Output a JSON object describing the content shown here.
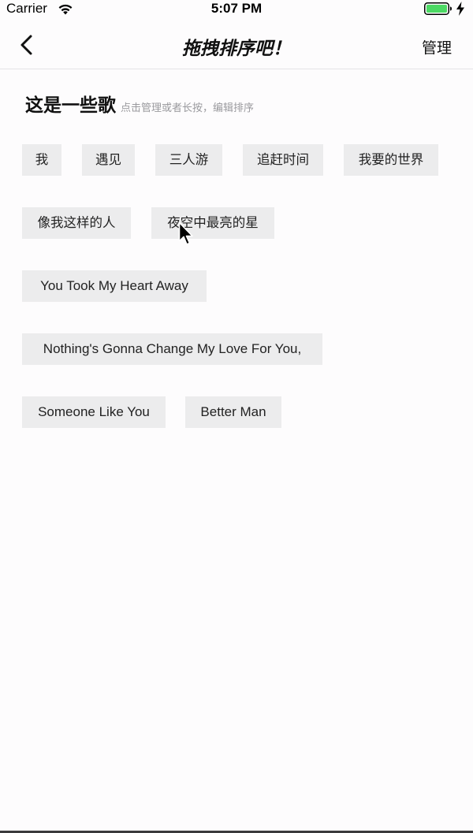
{
  "status_bar": {
    "carrier": "Carrier",
    "time": "5:07 PM",
    "icons": [
      "wifi-icon",
      "battery-icon",
      "charging-icon"
    ],
    "battery_color": "#4cd964"
  },
  "nav_bar": {
    "title": "拖拽排序吧！",
    "manage_label": "管理",
    "back_icon": "chevron-left-icon"
  },
  "section": {
    "title": "这是一些歌",
    "hint": "点击管理或者长按，编辑排序"
  },
  "songs": [
    "我",
    "遇见",
    "三人游",
    "追赶时间",
    "我要的世界",
    "像我这样的人",
    "夜空中最亮的星",
    "You Took My Heart Away",
    "Nothing's Gonna Change My Love For You,",
    "Someone Like You",
    "Better Man"
  ],
  "colors": {
    "tag_background": "#ececed",
    "background": "#fdfcfd",
    "hint_text": "#9a9a9e"
  }
}
